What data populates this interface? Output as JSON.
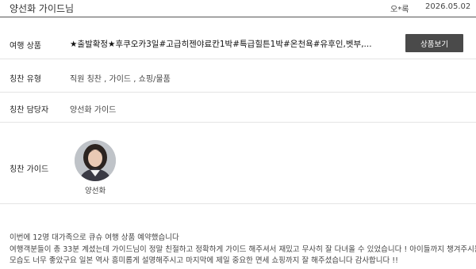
{
  "header": {
    "title": "양선화 가이드님",
    "author": "오*록",
    "date": "2026.05.02"
  },
  "details": {
    "product_label": "여행 상품",
    "product_value": "★출발확정★후쿠오카3일#고급히젠야료칸1박#특급힐튼1박#온천욕#유후인,벳부,...",
    "view_button": "상품보기",
    "type_label": "칭찬 유형",
    "type_value": "직원 칭찬 , 가이드 , 쇼핑/물품",
    "staff_label": "칭찬 담당자",
    "staff_value": "양선화 가이드",
    "guide_label": "칭찬 가이드",
    "guide_name": "양선화"
  },
  "review": {
    "line1": "이번에 12명 대가족으로 큐슈 여행 상품 예약했습니다",
    "line2": "여행객분들이 총 33분 계셨는데 가이드님이 정말 친절하고 정확하게 가이드 해주셔서 재밌고 무사히 잘 다녀올 수 있었습니다 ! 아이들까지 챙겨주시는",
    "line3": "모습도 너무 좋았구요 일본 역사 흥미롭게 설명해주시고 마지막에 제일 중요한 면세 쇼핑까지 잘 해주셨습니다 감사합니다 !!"
  },
  "colors": {
    "button_bg": "#4a4a4a",
    "header_rule": "#555555",
    "row_rule": "#e4e4e4"
  },
  "icons": {
    "avatar": "guide-profile-photo"
  }
}
